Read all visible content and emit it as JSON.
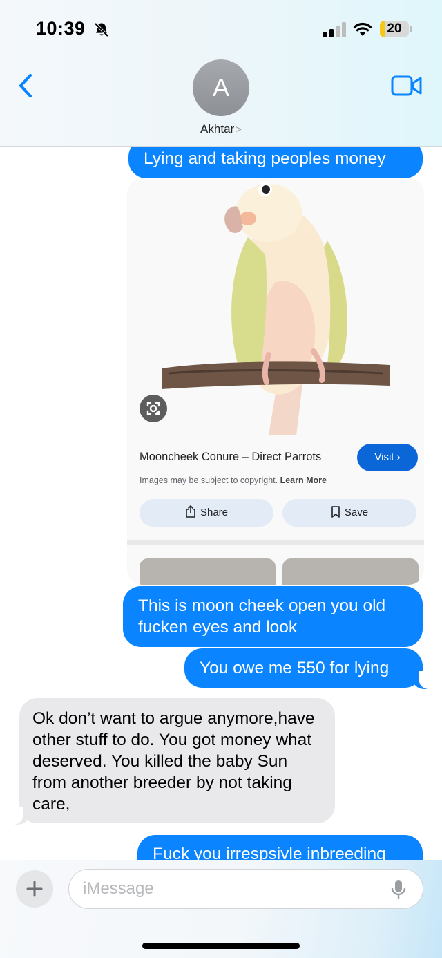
{
  "status_bar": {
    "time": "10:39",
    "battery": "20",
    "battery_level": 0.2
  },
  "header": {
    "avatar_initial": "A",
    "contact_name": "Akhtar",
    "contact_chevron": ">"
  },
  "messages": [
    {
      "direction": "sent",
      "text": "Lying and taking peoples money"
    },
    {
      "direction": "sent",
      "text": "This is moon cheek open you old fucken eyes and look"
    },
    {
      "direction": "sent",
      "text": "You owe me 550 for lying"
    },
    {
      "direction": "received",
      "text": "Ok don’t want to argue anymore,have other stuff to do. You  got money what deserved. You killed the baby Sun from another breeder by not taking care,"
    },
    {
      "direction": "sent",
      "text": "Fuck you irrespsivle inbreeding"
    }
  ],
  "image_card": {
    "title": "Mooncheek Conure – Direct Parrots",
    "visit_label": "Visit ›",
    "copyright_text": "Images may be subject to copyright.",
    "learn_more": "Learn More",
    "share_label": "Share",
    "save_label": "Save"
  },
  "composer": {
    "placeholder": "iMessage"
  },
  "colors": {
    "sent_bubble": "#0a84ff",
    "received_bubble": "#e9e9eb",
    "ios_blue": "#0a84ff",
    "google_blue": "#0b66d8"
  },
  "icons": [
    "silent-bell-icon",
    "signal-icon",
    "wifi-icon",
    "battery-icon",
    "back-chevron-icon",
    "video-call-icon",
    "lens-icon",
    "share-icon",
    "bookmark-icon",
    "plus-icon",
    "mic-icon"
  ]
}
